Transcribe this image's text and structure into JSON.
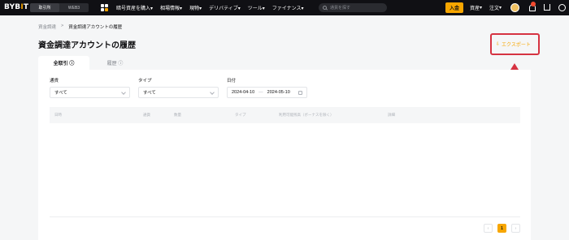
{
  "header": {
    "logo_main": "BYB",
    "logo_accent": "I",
    "logo_end": "T",
    "segments": [
      "取引所",
      "WEB3"
    ],
    "nav": [
      "暗号資産を購入",
      "相場情報",
      "現物",
      "デリバティブ",
      "ツール",
      "ファイナンス"
    ],
    "search_placeholder": "通貨を探す",
    "deposit": "入金",
    "assets": "資産",
    "orders": "注文",
    "colors": {
      "accent": "#f7a600",
      "bg": "#101014"
    }
  },
  "breadcrumb": {
    "parent": "資金調達",
    "sep": ">",
    "current": "資金調達アカウントの履歴"
  },
  "page_title": "資金調達アカウントの履歴",
  "export_label": "エクスポート",
  "tabs": [
    "全取引",
    "履歴"
  ],
  "filters": {
    "currency_label": "通貨",
    "currency_value": "すべて",
    "type_label": "タイプ",
    "type_value": "すべて",
    "date_label": "日付",
    "date_from": "2024-04-10",
    "date_sep": "—",
    "date_to": "2024-05-10"
  },
  "table": {
    "columns": [
      "日時",
      "通貨",
      "数量",
      "タイプ",
      "利用可能残高（ボーナスを除く）",
      "詳細"
    ]
  },
  "pagination": {
    "prev": "‹",
    "page": "1",
    "next": "›"
  }
}
